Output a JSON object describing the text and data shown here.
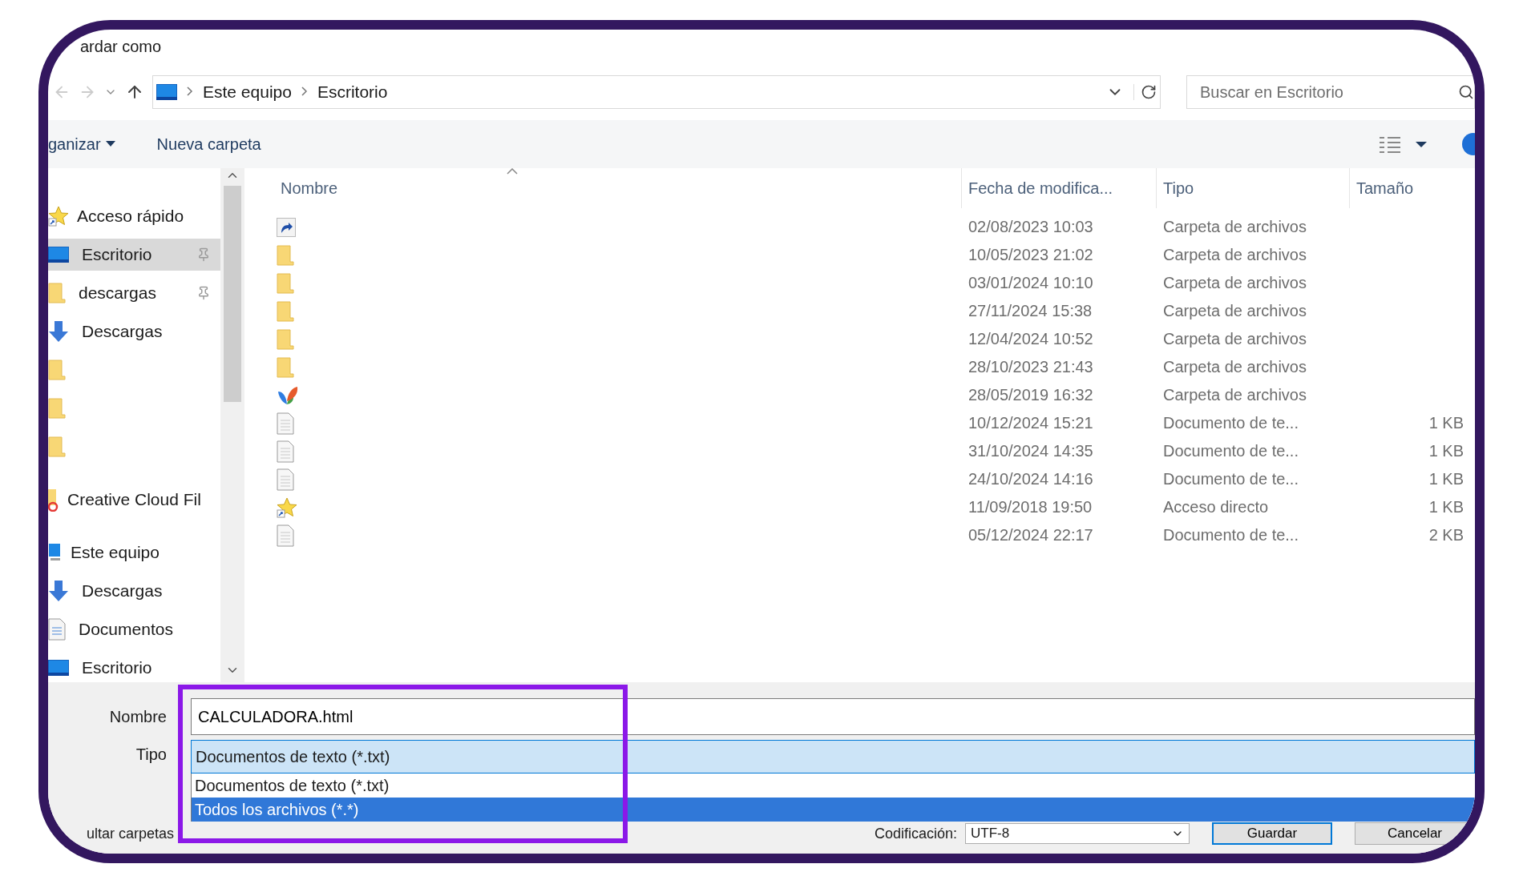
{
  "window": {
    "title": "ardar como"
  },
  "address": {
    "path": [
      "Este equipo",
      "Escritorio"
    ]
  },
  "search": {
    "placeholder": "Buscar en Escritorio"
  },
  "toolbar": {
    "organize": "ganizar",
    "new_folder": "Nueva carpeta"
  },
  "sidebar": {
    "items": [
      {
        "label": "Acceso rápido",
        "kind": "star",
        "selected": false,
        "children": [
          {
            "label": "Escritorio",
            "kind": "desktop",
            "selected": true,
            "pinned": true
          },
          {
            "label": "descargas",
            "kind": "folder",
            "selected": false,
            "pinned": true
          },
          {
            "label": "Descargas",
            "kind": "download",
            "selected": false,
            "pinned": false
          },
          {
            "kind": "folder",
            "selected": false,
            "pinned": false
          },
          {
            "kind": "folder",
            "selected": false,
            "pinned": false
          },
          {
            "kind": "folder",
            "selected": false,
            "pinned": false
          }
        ]
      },
      {
        "label": "Creative Cloud Fil",
        "kind": "cloud",
        "selected": false
      },
      {
        "label": "Este equipo",
        "kind": "computer",
        "selected": false,
        "children": [
          {
            "label": "Descargas",
            "kind": "download",
            "selected": false,
            "pinned": false
          },
          {
            "label": "Documentos",
            "kind": "documents",
            "selected": false,
            "pinned": false
          },
          {
            "label": "Escritorio",
            "kind": "desktop",
            "selected": false,
            "pinned": false
          }
        ]
      }
    ]
  },
  "table": {
    "columns": [
      "Nombre",
      "Fecha de modifica...",
      "Tipo",
      "Tamaño"
    ],
    "rows": [
      {
        "kind": "shortcut",
        "date": "02/08/2023 10:03",
        "type": "Carpeta de archivos"
      },
      {
        "kind": "folder",
        "date": "10/05/2023 21:02",
        "type": "Carpeta de archivos"
      },
      {
        "kind": "folder",
        "date": "03/01/2024 10:10",
        "type": "Carpeta de archivos"
      },
      {
        "kind": "folder",
        "date": "27/11/2024 15:38",
        "type": "Carpeta de archivos"
      },
      {
        "kind": "folder",
        "date": "12/04/2024 10:52",
        "type": "Carpeta de archivos"
      },
      {
        "kind": "folder",
        "date": "28/10/2023 21:43",
        "type": "Carpeta de archivos"
      },
      {
        "kind": "app",
        "date": "28/05/2019 16:32",
        "type": "Carpeta de archivos"
      },
      {
        "kind": "document",
        "date": "10/12/2024 15:21",
        "type": "Documento de te...",
        "size": "1 KB"
      },
      {
        "kind": "document",
        "date": "31/10/2024 14:35",
        "type": "Documento de te...",
        "size": "1 KB"
      },
      {
        "kind": "document",
        "date": "24/10/2024 14:16",
        "type": "Documento de te...",
        "size": "1 KB"
      },
      {
        "kind": "star",
        "date": "11/09/2018 19:50",
        "type": "Acceso directo",
        "size": "1 KB"
      },
      {
        "kind": "document",
        "date": "05/12/2024 22:17",
        "type": "Documento de te...",
        "size": "2 KB"
      }
    ]
  },
  "form": {
    "name_label": "Nombre",
    "name_value": "CALCULADORA.html",
    "type_label": "Tipo",
    "type_value": "Documentos de texto (*.txt)",
    "type_options": [
      {
        "label": "Documentos de texto (*.txt)",
        "selected": false
      },
      {
        "label": "Todos los archivos  (*.*)",
        "selected": true
      }
    ],
    "hide_folders": "ultar carpetas",
    "encoding_label": "Codificación:",
    "encoding_value": "UTF-8",
    "buttons": [
      "Guardar",
      "Cancelar"
    ]
  }
}
